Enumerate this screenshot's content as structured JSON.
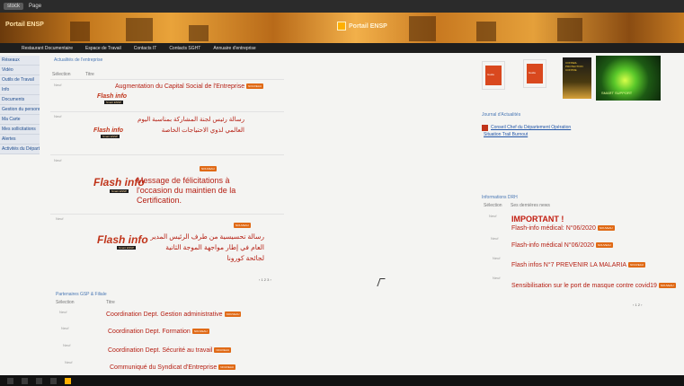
{
  "browser": {
    "address": "stock",
    "page": "Page"
  },
  "banner": {
    "left_logo": "Portail ENSP",
    "center_logo": "Portail ENSP"
  },
  "topnav": [
    "Restaurant Documentaire",
    "Espace de Travail",
    "Contacts IT",
    "Contacts SGHT",
    "Annuaire d'entreprise"
  ],
  "leftnav": [
    "Réseaux",
    "Vidéo",
    "Outils de Travail",
    "Info",
    "Documents",
    "Gestion du personnel",
    "Ma Carte",
    "Mes sollicitations",
    "Alertes",
    "Activités du Département"
  ],
  "left_section": {
    "title": "Actualités de l'entreprise",
    "col_select": "Sélection",
    "col_title": "Titre",
    "items": [
      {
        "meta": "Neuf",
        "text": "Augmentation du Capital Social de l'Entreprise",
        "badge": "NOUVEAU",
        "logo": "Flash info",
        "logo_sub": "Smart ENSP"
      },
      {
        "meta": "Neuf",
        "text": "رسالة رئيس لجنة المشاركة بمناسبة اليوم العالمي لذوي الاحتياجات الخاصة",
        "badge": "NOUVEAU",
        "logo": "Flash info",
        "logo_sub": "Smart ENSP"
      },
      {
        "meta": "Neuf",
        "text": "Message de félicitations à l'occasion du maintien de la Certification.",
        "badge": "NOUVEAU",
        "logo": "Flash info",
        "logo_sub": "Smart ENSP"
      },
      {
        "meta": "Neuf",
        "text": "رسالة تحسيسية من طرف الرئيس المدير العام في إطار مواجهة الموجة الثانية لجائحة كورونا",
        "badge": "NOUVEAU",
        "logo": "Flash info",
        "logo_sub": "Smart ENSP"
      }
    ],
    "pager": "‹ 1 2 3 ›"
  },
  "bottom_left": {
    "title": "Partenaires GSP & Filiale",
    "col_select": "Sélection",
    "col_title": "Titre",
    "items": [
      {
        "meta": "Neuf",
        "text": "Coordination Dept. Gestion administrative",
        "badge": "NOUVEAU"
      },
      {
        "meta": "Neuf",
        "text": "Coordination Dept. Formation",
        "badge": "NOUVEAU"
      },
      {
        "meta": "Neuf",
        "text": "Coordination Dept. Sécurité au travail",
        "badge": "NOUVEAU"
      },
      {
        "meta": "Neuf",
        "text": "Communiqué du Syndicat d'Entreprise",
        "badge": "NOUVEAU"
      }
    ]
  },
  "right_column": {
    "ad_text": "CONSEIL PROTECTION CONTRE",
    "ad_eye_text": "SMART SUPPORT",
    "book1_label": "Guide",
    "book2_label": "Guide",
    "event_title": "Journal d'Actualités",
    "event_link": "Conseil Chef du Département Opération",
    "event_sub": "Situation Trail Burnout",
    "flash_title": "Informations DRH",
    "col_select": "Sélection",
    "col_title": "Ses dernières news",
    "important": "IMPORTANT !",
    "items": [
      {
        "meta": "Neuf",
        "text": "Flash-info médical: N°06/2020",
        "badge": "NOUVEAU"
      },
      {
        "meta": "Neuf",
        "text": "Flash-info médical N°06/2020",
        "badge": "NOUVEAU"
      },
      {
        "meta": "Neuf",
        "text": "Flash infos N°7 PREVENIR LA MALARIA",
        "badge": "NOUVEAU"
      },
      {
        "meta": "Neuf",
        "text": "Sensibilisation sur le port de masque contre covid19",
        "badge": "NOUVEAU"
      }
    ],
    "pager": "‹ 1 2 ›"
  },
  "colors": {
    "accent_red": "#b51e12",
    "badge_orange": "#e06a16",
    "link_blue": "#4a78b5",
    "banner_gold": "#e9a33a"
  }
}
